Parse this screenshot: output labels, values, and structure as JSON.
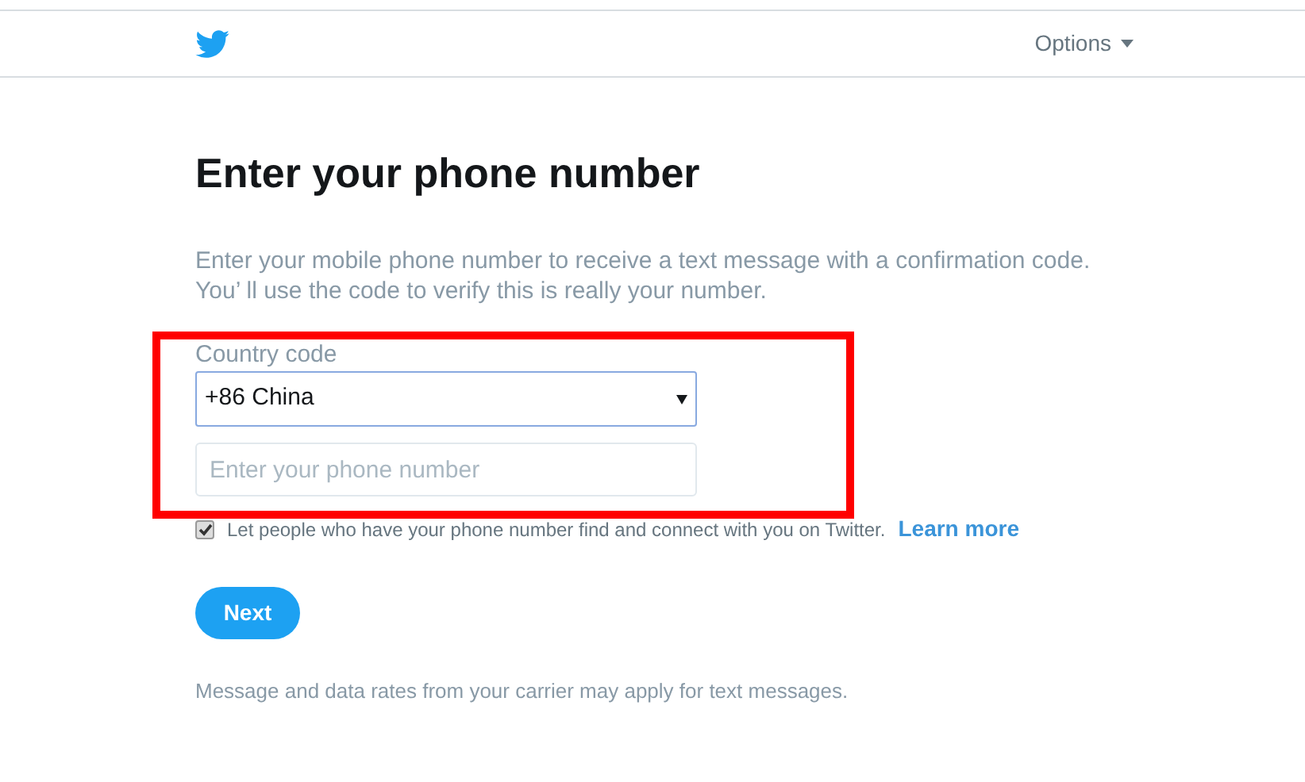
{
  "header": {
    "options_label": "Options"
  },
  "title": "Enter your phone number",
  "intro": "Enter your mobile phone number to receive a text message with a confirmation code. You’ ll use the code to verify this is really your number.",
  "country": {
    "label": "Country code",
    "value": "+86 China"
  },
  "phone": {
    "placeholder": "Enter your phone number"
  },
  "discoverable": {
    "checked": true,
    "label": "Let people who have your phone number find and connect with you on Twitter.",
    "link": "Learn more"
  },
  "next_button": "Next",
  "footnote": "Message and data rates from your carrier may apply for text messages.",
  "annotation": {
    "kind": "highlight",
    "color": "#ff0000"
  }
}
